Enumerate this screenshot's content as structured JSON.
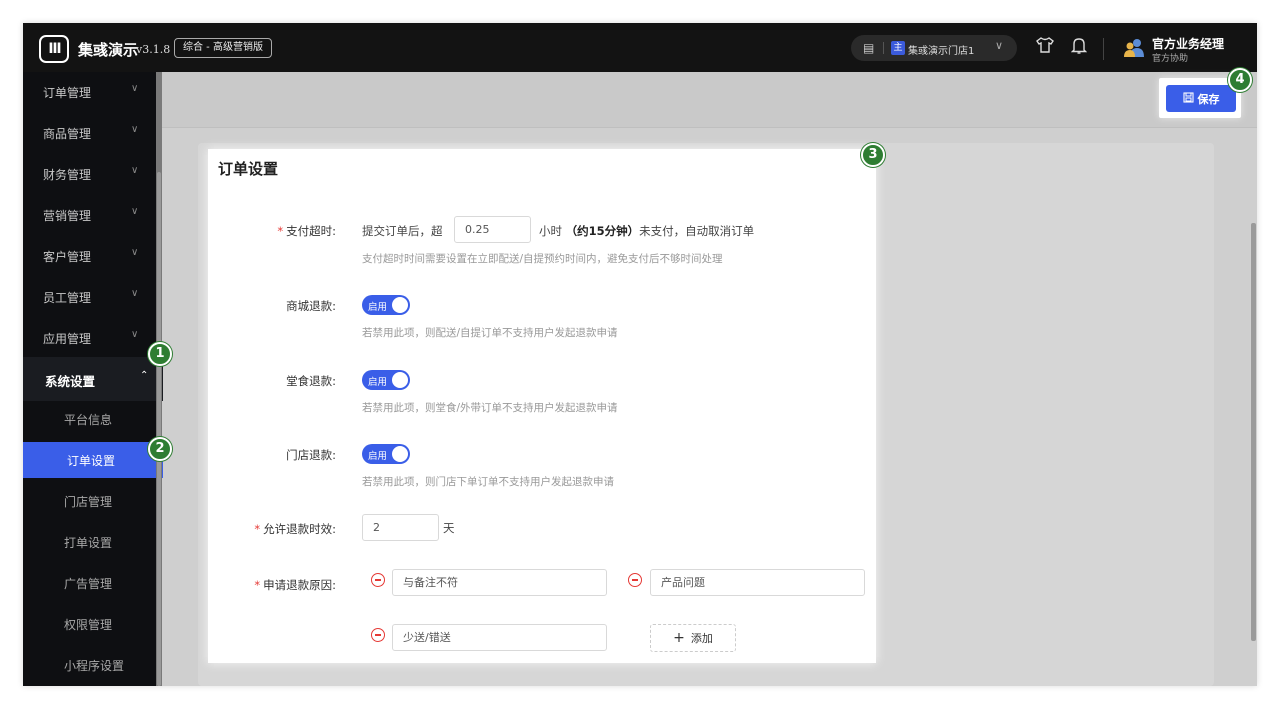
{
  "header": {
    "logo_text": "Ⅲ",
    "app_name": "集彧演示",
    "version": "v3.1.8",
    "plan_badge": "综合 - 高级营销版",
    "store": {
      "tag": "主",
      "name": "集彧演示门店1"
    },
    "user": {
      "name": "官方业务经理",
      "role": "官方协助"
    }
  },
  "sidebar": {
    "items": [
      {
        "label": "订单管理"
      },
      {
        "label": "商品管理"
      },
      {
        "label": "财务管理"
      },
      {
        "label": "营销管理"
      },
      {
        "label": "客户管理"
      },
      {
        "label": "员工管理"
      },
      {
        "label": "应用管理"
      }
    ],
    "active_group": "系统设置",
    "sub_items": [
      {
        "label": "平台信息"
      },
      {
        "label": "订单设置"
      },
      {
        "label": "门店管理"
      },
      {
        "label": "打单设置"
      },
      {
        "label": "广告管理"
      },
      {
        "label": "权限管理"
      },
      {
        "label": "小程序设置"
      }
    ]
  },
  "toolbar": {
    "save_label": "保存"
  },
  "form": {
    "title": "订单设置",
    "payment_timeout": {
      "label": "支付超时:",
      "prefix": "提交订单后，超",
      "value": "0.25",
      "suffix_unit": "小时",
      "suffix_note": "（约15分钟）",
      "suffix_text": "未支付，自动取消订单",
      "hint": "支付超时时间需要设置在立即配送/自提预约时间内，避免支付后不够时间处理"
    },
    "mall_refund": {
      "label": "商城退款:",
      "toggle_label": "启用",
      "hint": "若禁用此项，则配送/自提订单不支持用户发起退款申请"
    },
    "dinein_refund": {
      "label": "堂食退款:",
      "toggle_label": "启用",
      "hint": "若禁用此项，则堂食/外带订单不支持用户发起退款申请"
    },
    "store_refund": {
      "label": "门店退款:",
      "toggle_label": "启用",
      "hint": "若禁用此项，则门店下单订单不支持用户发起退款申请"
    },
    "refund_window": {
      "label": "允许退款时效:",
      "value": "2",
      "unit": "天"
    },
    "refund_reasons": {
      "label": "申请退款原因:",
      "reasons": [
        "与备注不符",
        "产品问题",
        "少送/错送"
      ],
      "add_label": "添加"
    }
  },
  "steps": [
    "1",
    "2",
    "3",
    "4"
  ],
  "colors": {
    "accent": "#3a5ee8",
    "step_badge": "#2e7d32",
    "required": "#e53935"
  }
}
